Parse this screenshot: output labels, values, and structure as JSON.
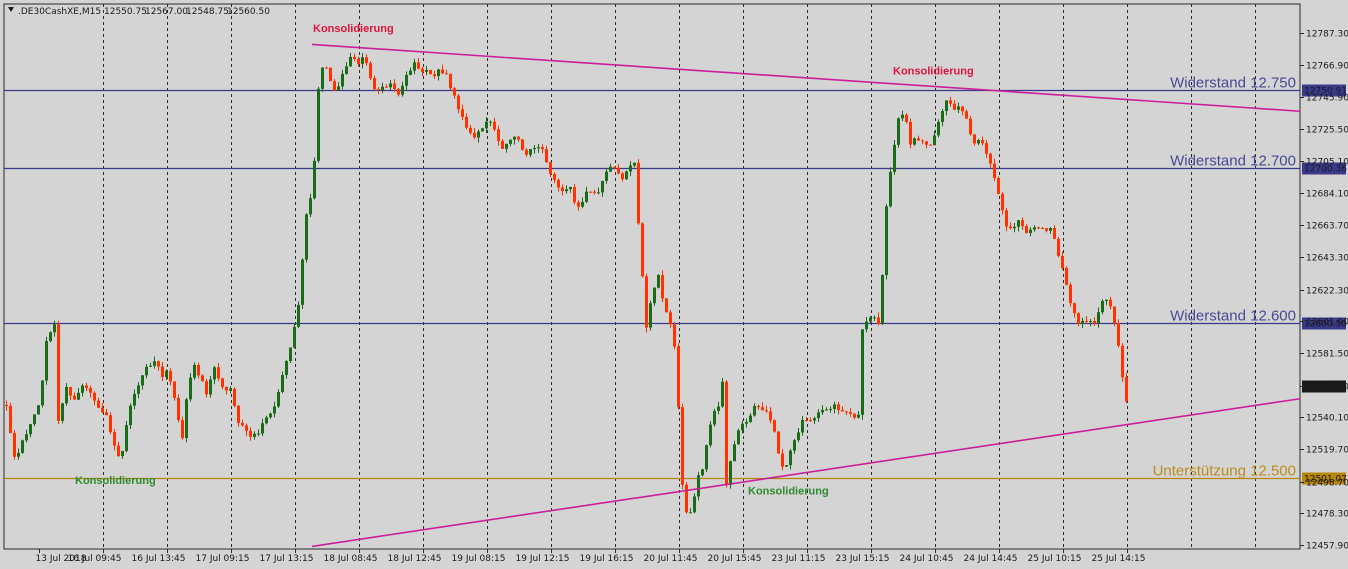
{
  "chart_data": {
    "type": "candlestick",
    "header": {
      "symbol": ".DE30CashXE,M15",
      "ohlc": [
        "12550.75",
        "12567.00",
        "12548.75",
        "12560.50"
      ]
    },
    "ylim": [
      12457.9,
      12797.0
    ],
    "price_ticks": [
      "12787.30",
      "12766.90",
      "12745.90",
      "12725.50",
      "12705.10",
      "12684.10",
      "12663.70",
      "12643.30",
      "12622.30",
      "12601.90",
      "12581.50",
      "12560.50",
      "12540.10",
      "12519.70",
      "12498.70",
      "12478.30",
      "12457.90"
    ],
    "time_ticks": [
      "13 Jul 2018",
      "16 Jul 09:45",
      "16 Jul 13:45",
      "17 Jul 09:15",
      "17 Jul 13:15",
      "18 Jul 08:45",
      "18 Jul 12:45",
      "19 Jul 08:15",
      "19 Jul 12:15",
      "19 Jul 16:15",
      "20 Jul 11:45",
      "20 Jul 15:45",
      "23 Jul 11:15",
      "23 Jul 15:15",
      "24 Jul 10:45",
      "24 Jul 14:45",
      "25 Jul 10:15",
      "25 Jul 14:15"
    ],
    "levels": [
      {
        "price": 12750.91,
        "tag": "12750.91",
        "label": "Widerstand 12.750",
        "color": "#3a3a8c"
      },
      {
        "price": 12700.36,
        "tag": "12700.36",
        "label": "Widerstand 12.700",
        "color": "#3a3a8c"
      },
      {
        "price": 12600.5,
        "tag": "12600.50",
        "label": "Widerstand 12.600",
        "color": "#3a3a8c"
      },
      {
        "price": 12501.07,
        "tag": "12501.07",
        "label": "Unterstützung 12.500",
        "color": "#b8860b"
      }
    ],
    "current_price": {
      "price": 12560.5,
      "tag": "12560.50"
    },
    "trendlines": [
      {
        "from": [
          0.0,
          12780.0
        ],
        "to": [
          1.0,
          12737.0
        ],
        "color": "#cc1f9a"
      },
      {
        "from": [
          0.0,
          12457.0
        ],
        "to": [
          1.0,
          12552.0
        ],
        "color": "#cc1f9a"
      }
    ],
    "annotations": [
      {
        "text": "Konsolidierung",
        "color": "#e0143c",
        "at_price": 12788.0
      },
      {
        "text": "Konsolidierung",
        "color": "#e0143c",
        "at_price": 12760.5
      },
      {
        "text": "Konsolidierung",
        "color": "#2e8b2e",
        "at_price": 12497.0
      },
      {
        "text": "Konsolidierung",
        "color": "#2e8b2e",
        "at_price": 12490.5
      }
    ],
    "colors": {
      "bull": "#1a6b1a",
      "bear": "#ff3300",
      "background": "#d4d4d4",
      "grid": "#2a2a2a"
    },
    "path": [
      [
        0,
        12548
      ],
      [
        8,
        12513
      ],
      [
        22,
        12532
      ],
      [
        34,
        12550
      ],
      [
        40,
        12590
      ],
      [
        48,
        12600
      ],
      [
        52,
        12538
      ],
      [
        60,
        12558
      ],
      [
        68,
        12553
      ],
      [
        78,
        12562
      ],
      [
        88,
        12550
      ],
      [
        100,
        12540
      ],
      [
        106,
        12528
      ],
      [
        110,
        12515
      ],
      [
        116,
        12520
      ],
      [
        124,
        12548
      ],
      [
        134,
        12565
      ],
      [
        142,
        12573
      ],
      [
        150,
        12575
      ],
      [
        156,
        12567
      ],
      [
        162,
        12570
      ],
      [
        170,
        12545
      ],
      [
        176,
        12527
      ],
      [
        182,
        12562
      ],
      [
        188,
        12574
      ],
      [
        194,
        12566
      ],
      [
        200,
        12556
      ],
      [
        208,
        12572
      ],
      [
        216,
        12560
      ],
      [
        224,
        12557
      ],
      [
        232,
        12537
      ],
      [
        240,
        12530
      ],
      [
        250,
        12528
      ],
      [
        258,
        12541
      ],
      [
        266,
        12543
      ],
      [
        272,
        12556
      ],
      [
        280,
        12578
      ],
      [
        286,
        12590
      ],
      [
        292,
        12612
      ],
      [
        296,
        12642
      ],
      [
        300,
        12670
      ],
      [
        306,
        12685
      ],
      [
        312,
        12750
      ],
      [
        318,
        12773
      ],
      [
        322,
        12760
      ],
      [
        330,
        12748
      ],
      [
        338,
        12764
      ],
      [
        346,
        12773
      ],
      [
        352,
        12766
      ],
      [
        358,
        12773
      ],
      [
        364,
        12759
      ],
      [
        370,
        12748
      ],
      [
        378,
        12754
      ],
      [
        386,
        12753
      ],
      [
        394,
        12748
      ],
      [
        402,
        12763
      ],
      [
        408,
        12767
      ],
      [
        414,
        12762
      ],
      [
        420,
        12765
      ],
      [
        426,
        12757
      ],
      [
        432,
        12763
      ],
      [
        440,
        12762
      ],
      [
        446,
        12748
      ],
      [
        452,
        12740
      ],
      [
        458,
        12730
      ],
      [
        466,
        12720
      ],
      [
        474,
        12725
      ],
      [
        482,
        12733
      ],
      [
        488,
        12725
      ],
      [
        496,
        12712
      ],
      [
        504,
        12720
      ],
      [
        510,
        12720
      ],
      [
        518,
        12710
      ],
      [
        526,
        12712
      ],
      [
        532,
        12715
      ],
      [
        538,
        12710
      ],
      [
        544,
        12696
      ],
      [
        552,
        12688
      ],
      [
        558,
        12684
      ],
      [
        564,
        12688
      ],
      [
        570,
        12676
      ],
      [
        576,
        12678
      ],
      [
        582,
        12687
      ],
      [
        590,
        12683
      ],
      [
        598,
        12697
      ],
      [
        604,
        12700
      ],
      [
        610,
        12701
      ],
      [
        616,
        12693
      ],
      [
        622,
        12700
      ],
      [
        628,
        12705
      ],
      [
        632,
        12665
      ],
      [
        636,
        12630
      ],
      [
        640,
        12597
      ],
      [
        646,
        12622
      ],
      [
        652,
        12630
      ],
      [
        658,
        12610
      ],
      [
        664,
        12600
      ],
      [
        668,
        12585
      ],
      [
        672,
        12548
      ],
      [
        676,
        12495
      ],
      [
        680,
        12478
      ],
      [
        686,
        12482
      ],
      [
        692,
        12502
      ],
      [
        696,
        12508
      ],
      [
        700,
        12522
      ],
      [
        706,
        12542
      ],
      [
        712,
        12546
      ],
      [
        716,
        12562
      ],
      [
        720,
        12496
      ],
      [
        726,
        12520
      ],
      [
        732,
        12532
      ],
      [
        740,
        12537
      ],
      [
        748,
        12548
      ],
      [
        756,
        12546
      ],
      [
        762,
        12543
      ],
      [
        768,
        12530
      ],
      [
        774,
        12510
      ],
      [
        778,
        12506
      ],
      [
        784,
        12520
      ],
      [
        790,
        12527
      ],
      [
        796,
        12538
      ],
      [
        804,
        12538
      ],
      [
        812,
        12542
      ],
      [
        820,
        12546
      ],
      [
        828,
        12548
      ],
      [
        834,
        12545
      ],
      [
        840,
        12542
      ],
      [
        846,
        12540
      ],
      [
        852,
        12540
      ],
      [
        856,
        12598
      ],
      [
        862,
        12604
      ],
      [
        868,
        12603
      ],
      [
        874,
        12600
      ],
      [
        878,
        12663
      ],
      [
        884,
        12697
      ],
      [
        888,
        12717
      ],
      [
        892,
        12732
      ],
      [
        898,
        12736
      ],
      [
        904,
        12716
      ],
      [
        910,
        12720
      ],
      [
        916,
        12718
      ],
      [
        922,
        12715
      ],
      [
        928,
        12720
      ],
      [
        934,
        12735
      ],
      [
        938,
        12742
      ],
      [
        942,
        12748
      ],
      [
        946,
        12735
      ],
      [
        952,
        12740
      ],
      [
        956,
        12736
      ],
      [
        960,
        12732
      ],
      [
        966,
        12716
      ],
      [
        972,
        12719
      ],
      [
        978,
        12715
      ],
      [
        984,
        12702
      ],
      [
        990,
        12688
      ],
      [
        996,
        12672
      ],
      [
        1002,
        12660
      ],
      [
        1008,
        12662
      ],
      [
        1014,
        12668
      ],
      [
        1020,
        12658
      ],
      [
        1026,
        12660
      ],
      [
        1034,
        12664
      ],
      [
        1040,
        12660
      ],
      [
        1046,
        12661
      ],
      [
        1050,
        12648
      ],
      [
        1056,
        12635
      ],
      [
        1062,
        12620
      ],
      [
        1066,
        12610
      ],
      [
        1072,
        12601
      ],
      [
        1080,
        12603
      ],
      [
        1088,
        12602
      ],
      [
        1096,
        12616
      ],
      [
        1102,
        12614
      ],
      [
        1106,
        12606
      ],
      [
        1110,
        12597
      ],
      [
        1114,
        12578
      ],
      [
        1118,
        12555
      ],
      [
        1122,
        12548
      ],
      [
        1126,
        12560
      ]
    ]
  }
}
